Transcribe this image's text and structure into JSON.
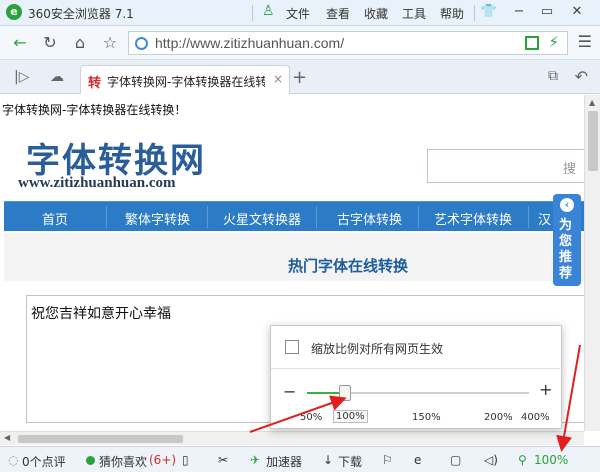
{
  "window": {
    "title": "360安全浏览器 7.1",
    "menus": [
      "文件",
      "查看",
      "收藏",
      "工具",
      "帮助"
    ]
  },
  "address_bar": {
    "url": "http://www.zitizhuanhuan.com/"
  },
  "tabs": [
    {
      "favicon": "转",
      "label": "字体转换网-字体转换器在线转换",
      "close": "×"
    }
  ],
  "page": {
    "top_text": "字体转换网-字体转换器在线转换！",
    "site_logo": "字体转换网",
    "site_domain": "www.zitizhuanhuan.com",
    "nav_items": [
      "首页",
      "繁体字转换",
      "火星文转换器",
      "古字体转换",
      "艺术字体转换",
      "汉"
    ],
    "hot_title": "热门字体在线转换",
    "textarea_value": "祝您吉祥如意开心幸福",
    "side_tab_text": "为您推荐"
  },
  "zoom_popup": {
    "checkbox_label": "缩放比例对所有网页生效",
    "checked": false,
    "minus": "−",
    "plus": "+",
    "ticks": [
      "50%",
      "100%",
      "150%",
      "200%",
      "400%"
    ],
    "selected_tick": "100%",
    "level_fraction": 0.17
  },
  "status_bar": {
    "comments": "0个点评",
    "guess_label": "猜你喜欢",
    "guess_count": "(6+)",
    "accelerator": "加速器",
    "download": "下载",
    "zoom": "100%"
  },
  "colors": {
    "accent_green": "#2aa13a",
    "nav_blue": "#2b7bc6",
    "annotation_red": "#e02020"
  }
}
